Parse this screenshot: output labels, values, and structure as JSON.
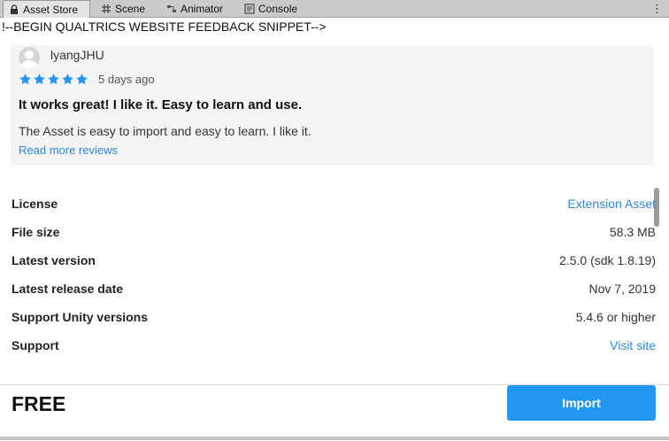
{
  "tabs": [
    {
      "label": "Asset Store",
      "icon": "lock-icon",
      "active": true
    },
    {
      "label": "Scene",
      "icon": "grid-icon"
    },
    {
      "label": "Animator",
      "icon": "animator-icon"
    },
    {
      "label": "Console",
      "icon": "console-icon"
    }
  ],
  "snippet_text": "!--BEGIN QUALTRICS WEBSITE FEEDBACK SNIPPET-->",
  "review": {
    "username": "lyangJHU",
    "rating": 5,
    "date": "5 days ago",
    "title": "It works great! I like it. Easy to learn and use.",
    "body": "The Asset is easy to import and easy to learn. I like it.",
    "read_more": "Read more reviews"
  },
  "details": [
    {
      "label": "License",
      "value": "Extension Asset",
      "link": true
    },
    {
      "label": "File size",
      "value": "58.3 MB"
    },
    {
      "label": "Latest version",
      "value": "2.5.0 (sdk 1.8.19)"
    },
    {
      "label": "Latest release date",
      "value": "Nov 7, 2019"
    },
    {
      "label": "Support Unity versions",
      "value": "5.4.6 or higher"
    },
    {
      "label": "Support",
      "value": "Visit site",
      "link": true
    }
  ],
  "footer": {
    "price": "FREE",
    "import_label": "Import"
  },
  "colors": {
    "accent": "#2196f3",
    "link": "#2e86de",
    "star": "#2196f3"
  }
}
